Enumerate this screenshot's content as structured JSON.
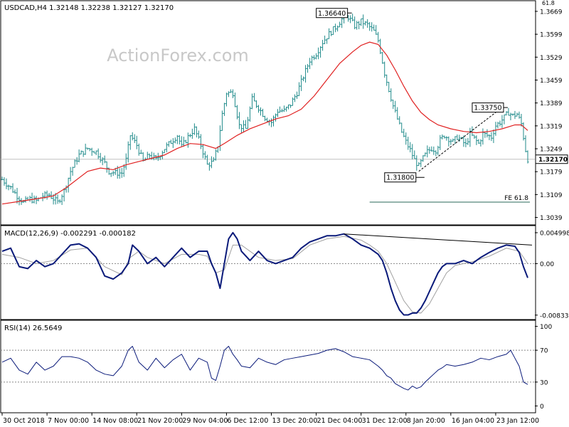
{
  "colors": {
    "price_bars": "#1f8a8a",
    "moving_average": "#e02020",
    "macd_main": "#0a1a7a",
    "macd_signal": "#a0a0a0",
    "rsi_line": "#0a1a7a",
    "trendline": "#000000",
    "fe_line": "#2a6a5a",
    "watermark": "#c8c8c8"
  },
  "watermark": "ActionForex.com",
  "chart_data": [
    {
      "type": "ohlc",
      "panel": "price",
      "title": "USDCAD,H4  1.32148 1.32238 1.32127 1.32170",
      "y_ticks": [
        1.3669,
        1.3599,
        1.3529,
        1.3459,
        1.3389,
        1.3319,
        1.3249,
        1.3179,
        1.3109,
        1.3039
      ],
      "ylim": [
        1.3025,
        1.3695
      ],
      "current_price": "1.32170",
      "annotations": [
        {
          "text": "1.36640",
          "x": 80.5,
          "value": 1.3664
        },
        {
          "text": "1.31800",
          "x": 97.5,
          "value": 1.318
        },
        {
          "text": "1.33750",
          "x": 117.0,
          "value": 1.3375
        }
      ],
      "fe_label": "FE 61.8",
      "fe_level": 1.3086,
      "fe_x_range": [
        86.0,
        123.5
      ],
      "corner_label": "61.8",
      "close_path": [
        [
          0,
          1.3155
        ],
        [
          2,
          1.313
        ],
        [
          3.5,
          1.3105
        ],
        [
          5,
          1.3085
        ],
        [
          6.5,
          1.3095
        ],
        [
          8,
          1.309
        ],
        [
          9.5,
          1.3105
        ],
        [
          11,
          1.3108
        ],
        [
          13,
          1.3085
        ],
        [
          14.5,
          1.312
        ],
        [
          16,
          1.318
        ],
        [
          18,
          1.323
        ],
        [
          20,
          1.325
        ],
        [
          22,
          1.324
        ],
        [
          24,
          1.3205
        ],
        [
          25,
          1.318
        ],
        [
          26.5,
          1.3175
        ],
        [
          28,
          1.3175
        ],
        [
          29,
          1.3215
        ],
        [
          30,
          1.329
        ],
        [
          31.5,
          1.326
        ],
        [
          33,
          1.321
        ],
        [
          34.5,
          1.323
        ],
        [
          36,
          1.3215
        ],
        [
          38,
          1.325
        ],
        [
          39.5,
          1.327
        ],
        [
          41,
          1.329
        ],
        [
          42,
          1.3255
        ],
        [
          43.5,
          1.3285
        ],
        [
          45,
          1.331
        ],
        [
          46.5,
          1.326
        ],
        [
          48,
          1.32
        ],
        [
          49.5,
          1.321
        ],
        [
          50.5,
          1.326
        ],
        [
          51.5,
          1.3355
        ],
        [
          52.5,
          1.342
        ],
        [
          54,
          1.342
        ],
        [
          55.5,
          1.332
        ],
        [
          57,
          1.331
        ],
        [
          58.5,
          1.34
        ],
        [
          60,
          1.3375
        ],
        [
          61.5,
          1.3345
        ],
        [
          63,
          1.333
        ],
        [
          64.5,
          1.3365
        ],
        [
          66,
          1.3365
        ],
        [
          67.5,
          1.3385
        ],
        [
          69,
          1.342
        ],
        [
          70.5,
          1.347
        ],
        [
          72,
          1.352
        ],
        [
          73.5,
          1.354
        ],
        [
          75,
          1.3575
        ],
        [
          76.5,
          1.36
        ],
        [
          78,
          1.362
        ],
        [
          79.5,
          1.3645
        ],
        [
          81,
          1.3652
        ],
        [
          82.5,
          1.3625
        ],
        [
          84,
          1.3638
        ],
        [
          85.5,
          1.3628
        ],
        [
          87,
          1.3608
        ],
        [
          88,
          1.358
        ],
        [
          88.8,
          1.353
        ],
        [
          89.5,
          1.348
        ],
        [
          90.5,
          1.343
        ],
        [
          91.5,
          1.338
        ],
        [
          92.5,
          1.334
        ],
        [
          93.5,
          1.33
        ],
        [
          94.5,
          1.327
        ],
        [
          95.5,
          1.3245
        ],
        [
          96.5,
          1.3215
        ],
        [
          97.5,
          1.3195
        ],
        [
          98.5,
          1.322
        ],
        [
          99.5,
          1.324
        ],
        [
          100.5,
          1.325
        ],
        [
          101.5,
          1.3245
        ],
        [
          102.5,
          1.3275
        ],
        [
          103.5,
          1.329
        ],
        [
          104.5,
          1.328
        ],
        [
          105.5,
          1.327
        ],
        [
          106.5,
          1.3285
        ],
        [
          107.5,
          1.3275
        ],
        [
          108.5,
          1.326
        ],
        [
          109.5,
          1.3295
        ],
        [
          110.5,
          1.328
        ],
        [
          111.5,
          1.3265
        ],
        [
          112.5,
          1.3295
        ],
        [
          113.5,
          1.329
        ],
        [
          114.5,
          1.3285
        ],
        [
          115.5,
          1.332
        ],
        [
          116.5,
          1.333
        ],
        [
          117.5,
          1.3345
        ],
        [
          118.5,
          1.336
        ],
        [
          119.5,
          1.335
        ],
        [
          120.5,
          1.3355
        ],
        [
          121.5,
          1.3325
        ],
        [
          122,
          1.3285
        ],
        [
          122.5,
          1.3245
        ],
        [
          123,
          1.3217
        ]
      ],
      "ma_path": [
        [
          0,
          1.308
        ],
        [
          5,
          1.309
        ],
        [
          10,
          1.31
        ],
        [
          12,
          1.3105
        ],
        [
          15,
          1.313
        ],
        [
          18,
          1.316
        ],
        [
          20,
          1.318
        ],
        [
          23,
          1.319
        ],
        [
          26,
          1.3185
        ],
        [
          29,
          1.32
        ],
        [
          32,
          1.321
        ],
        [
          35,
          1.322
        ],
        [
          38,
          1.323
        ],
        [
          41,
          1.325
        ],
        [
          44,
          1.3265
        ],
        [
          47,
          1.3262
        ],
        [
          50,
          1.325
        ],
        [
          52,
          1.3265
        ],
        [
          55,
          1.329
        ],
        [
          58,
          1.331
        ],
        [
          61,
          1.3325
        ],
        [
          64,
          1.334
        ],
        [
          67,
          1.335
        ],
        [
          70,
          1.337
        ],
        [
          73,
          1.341
        ],
        [
          76,
          1.346
        ],
        [
          79,
          1.351
        ],
        [
          82,
          1.3545
        ],
        [
          84,
          1.3565
        ],
        [
          86,
          1.3575
        ],
        [
          88,
          1.3568
        ],
        [
          90,
          1.3535
        ],
        [
          92,
          1.349
        ],
        [
          94,
          1.344
        ],
        [
          96,
          1.3395
        ],
        [
          98,
          1.336
        ],
        [
          100,
          1.3338
        ],
        [
          102,
          1.3322
        ],
        [
          105,
          1.331
        ],
        [
          108,
          1.3302
        ],
        [
          111,
          1.3298
        ],
        [
          114,
          1.3302
        ],
        [
          117,
          1.331
        ],
        [
          120,
          1.3322
        ],
        [
          121.5,
          1.3322
        ],
        [
          123,
          1.3305
        ]
      ],
      "trendline": [
        [
          97.5,
          1.318
        ],
        [
          117.0,
          1.3375
        ]
      ]
    },
    {
      "type": "line",
      "panel": "macd",
      "title": "MACD(12,26,9) -0.002291 -0.000182",
      "y_ticks": [
        0.004998,
        0.0,
        -0.00833
      ],
      "y_tick_labels": [
        "0.004998",
        "0.00",
        "-0.00833"
      ],
      "ylim": [
        -0.0087,
        0.0058
      ],
      "zero_line": 0.0,
      "series": [
        {
          "name": "MACD",
          "x": [
            0,
            2,
            4,
            6,
            8,
            10,
            12,
            14,
            16,
            18,
            20,
            22,
            24,
            26,
            28,
            29.5,
            30.5,
            32,
            34,
            36,
            38,
            40,
            42,
            44,
            46,
            48,
            49,
            50,
            51,
            52,
            53,
            54,
            55,
            56,
            58,
            60,
            62,
            64,
            66,
            68,
            70,
            72,
            74,
            76,
            78,
            80,
            82,
            84,
            86,
            88,
            89,
            90,
            91,
            92,
            93,
            94,
            95,
            96,
            97,
            98,
            99,
            100,
            101,
            102,
            103,
            104,
            106,
            108,
            110,
            112,
            114,
            116,
            118,
            120,
            121,
            122,
            123
          ],
          "values": [
            0.002,
            0.0025,
            -0.0005,
            -0.0008,
            0.0005,
            -0.0005,
            0.0,
            0.0015,
            0.003,
            0.0032,
            0.0025,
            0.001,
            -0.002,
            -0.0025,
            -0.0015,
            0.0,
            0.003,
            0.002,
            0.0,
            0.001,
            -0.0005,
            0.001,
            0.0025,
            0.001,
            0.002,
            0.002,
            0.0,
            -0.0015,
            -0.004,
            0.0,
            0.004,
            0.005,
            0.004,
            0.002,
            0.0005,
            0.002,
            0.0005,
            0.0,
            0.0005,
            0.001,
            0.0025,
            0.0035,
            0.004,
            0.0045,
            0.0045,
            0.0048,
            0.004,
            0.003,
            0.0025,
            0.0015,
            0.0005,
            -0.0015,
            -0.004,
            -0.006,
            -0.0075,
            -0.0083,
            -0.0083,
            -0.008,
            -0.008,
            -0.0072,
            -0.006,
            -0.0045,
            -0.003,
            -0.0015,
            -0.0005,
            0.0,
            0.0,
            0.0005,
            0.0,
            0.001,
            0.0018,
            0.0025,
            0.003,
            0.0028,
            0.0018,
            -0.0005,
            -0.0023
          ]
        },
        {
          "name": "Signal",
          "x": [
            0,
            4,
            8,
            12,
            16,
            20,
            24,
            28,
            30,
            32,
            34,
            38,
            42,
            46,
            48,
            50,
            52,
            54,
            56,
            60,
            64,
            68,
            72,
            76,
            80,
            84,
            86,
            88,
            90,
            92,
            94,
            96,
            98,
            100,
            102,
            104,
            106,
            110,
            114,
            118,
            121,
            123
          ],
          "values": [
            0.0015,
            0.001,
            0.0,
            0.0005,
            0.0022,
            0.0025,
            -0.0005,
            -0.0018,
            0.001,
            0.002,
            0.001,
            0.0,
            0.0015,
            0.0015,
            0.0012,
            -0.0015,
            -0.001,
            0.003,
            0.003,
            0.001,
            0.0005,
            0.0008,
            0.003,
            0.004,
            0.0044,
            0.0038,
            0.003,
            0.002,
            0.0,
            -0.003,
            -0.006,
            -0.0078,
            -0.008,
            -0.0065,
            -0.004,
            -0.0015,
            -0.0003,
            0.0003,
            0.0012,
            0.0025,
            0.002,
            0.0
          ]
        }
      ],
      "trendline": [
        [
          80,
          0.0048
        ],
        [
          123,
          0.003
        ]
      ]
    },
    {
      "type": "line",
      "panel": "rsi",
      "title": "RSI(14) 26.5649",
      "y_ticks": [
        100,
        70,
        30,
        0
      ],
      "ylim": [
        -5,
        105
      ],
      "levels": [
        70,
        30
      ],
      "series": [
        {
          "name": "RSI",
          "x": [
            0,
            2,
            4,
            6,
            8,
            10,
            12,
            14,
            16,
            18,
            20,
            22,
            24,
            26,
            28,
            29.5,
            30.5,
            32,
            34,
            36,
            38,
            40,
            42,
            44,
            46,
            48,
            49,
            50,
            51,
            52,
            53,
            54,
            55,
            56,
            58,
            60,
            62,
            64,
            66,
            68,
            70,
            72,
            74,
            76,
            78,
            80,
            82,
            84,
            86,
            88,
            89,
            90,
            91,
            92,
            93,
            94,
            95,
            96,
            97,
            98,
            99,
            100,
            101,
            102,
            103,
            104,
            106,
            108,
            110,
            112,
            114,
            116,
            118,
            119,
            120,
            121,
            122,
            123
          ],
          "values": [
            55,
            60,
            45,
            40,
            55,
            45,
            50,
            62,
            62,
            60,
            55,
            45,
            40,
            38,
            50,
            70,
            75,
            55,
            45,
            60,
            48,
            58,
            65,
            45,
            60,
            55,
            35,
            32,
            50,
            70,
            75,
            65,
            58,
            50,
            48,
            60,
            55,
            52,
            58,
            60,
            62,
            64,
            66,
            70,
            72,
            68,
            62,
            60,
            58,
            50,
            45,
            38,
            35,
            28,
            25,
            22,
            20,
            25,
            22,
            24,
            30,
            35,
            40,
            45,
            48,
            52,
            50,
            52,
            55,
            60,
            58,
            62,
            65,
            70,
            60,
            50,
            30,
            27
          ]
        }
      ]
    }
  ],
  "x_axis": {
    "x_max": 124,
    "ticks": [
      {
        "label": "30 Oct 2018",
        "x": 0
      },
      {
        "label": "7 Nov 00:00",
        "x": 10.5
      },
      {
        "label": "14 Nov 08:00",
        "x": 21
      },
      {
        "label": "21 Nov 20:00",
        "x": 31.5
      },
      {
        "label": "29 Nov 04:00",
        "x": 42
      },
      {
        "label": "6 Dec 12:00",
        "x": 52.5
      },
      {
        "label": "13 Dec 20:00",
        "x": 63
      },
      {
        "label": "21 Dec 04:00",
        "x": 73.5
      },
      {
        "label": "31 Dec 12:00",
        "x": 84
      },
      {
        "label": "8 Jan 20:00",
        "x": 94.5
      },
      {
        "label": "16 Jan 04:00",
        "x": 105
      },
      {
        "label": "23 Jan 12:00",
        "x": 115.5
      }
    ]
  }
}
